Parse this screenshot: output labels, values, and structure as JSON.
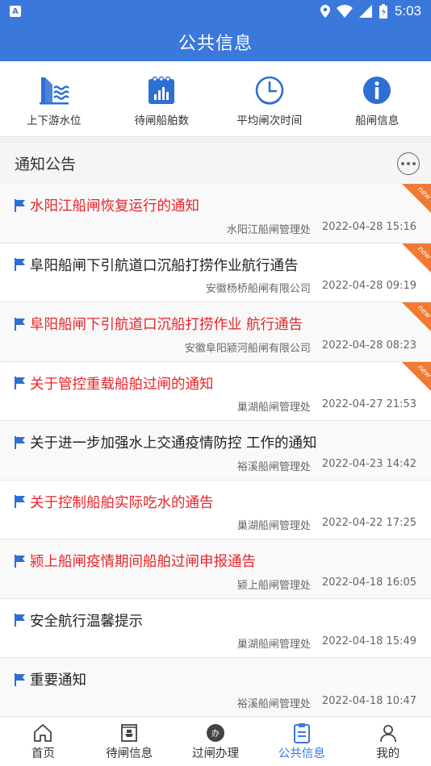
{
  "status": {
    "time": "5:03",
    "left_badge": "A"
  },
  "header": {
    "title": "公共信息"
  },
  "quick_links": [
    {
      "label": "上下游水位",
      "icon": "water-level-icon"
    },
    {
      "label": "待闸船舶数",
      "icon": "bar-chart-icon"
    },
    {
      "label": "平均闸次时间",
      "icon": "clock-icon"
    },
    {
      "label": "船闸信息",
      "icon": "info-icon"
    }
  ],
  "section": {
    "title": "通知公告",
    "more_icon": "more-dots-icon"
  },
  "notices": [
    {
      "title": "水阳江船闸恢复运行的通知",
      "org": "水阳江船闸管理处",
      "time": "2022-04-28 15:16",
      "highlight": true,
      "badge": "new"
    },
    {
      "title": "阜阳船闸下引航道口沉船打捞作业航行通告",
      "org": "安徽杨桥船闸有限公司",
      "time": "2022-04-28 09:19",
      "highlight": false,
      "badge": "new"
    },
    {
      "title": "阜阳船闸下引航道口沉船打捞作业 航行通告",
      "org": "安徽阜阳颍河船闸有限公司",
      "time": "2022-04-28 08:23",
      "highlight": true,
      "badge": "new"
    },
    {
      "title": "关于管控重载船舶过闸的通知",
      "org": "巢湖船闸管理处",
      "time": "2022-04-27 21:53",
      "highlight": true,
      "badge": "new"
    },
    {
      "title": "关于进一步加强水上交通疫情防控 工作的通知",
      "org": "裕溪船闸管理处",
      "time": "2022-04-23 14:42",
      "highlight": false,
      "badge": ""
    },
    {
      "title": "关于控制船舶实际吃水的通告",
      "org": "巢湖船闸管理处",
      "time": "2022-04-22 17:25",
      "highlight": true,
      "badge": ""
    },
    {
      "title": "颍上船闸疫情期间船舶过闸申报通告",
      "org": "颍上船闸管理处",
      "time": "2022-04-18 16:05",
      "highlight": true,
      "badge": ""
    },
    {
      "title": "安全航行温馨提示",
      "org": "巢湖船闸管理处",
      "time": "2022-04-18 15:49",
      "highlight": false,
      "badge": ""
    },
    {
      "title": "重要通知",
      "org": "裕溪船闸管理处",
      "time": "2022-04-18 10:47",
      "highlight": false,
      "badge": ""
    }
  ],
  "bottom_nav": [
    {
      "label": "首页",
      "icon": "home-icon",
      "active": false
    },
    {
      "label": "待闸信息",
      "icon": "ship-wait-icon",
      "active": false
    },
    {
      "label": "过闸办理",
      "icon": "process-icon",
      "badge": "办",
      "active": false
    },
    {
      "label": "公共信息",
      "icon": "clipboard-icon",
      "active": true
    },
    {
      "label": "我的",
      "icon": "user-icon",
      "active": false
    }
  ],
  "colors": {
    "primary": "#3a78dc",
    "highlight_text": "#e8242a",
    "new_badge": "#f07a32"
  }
}
